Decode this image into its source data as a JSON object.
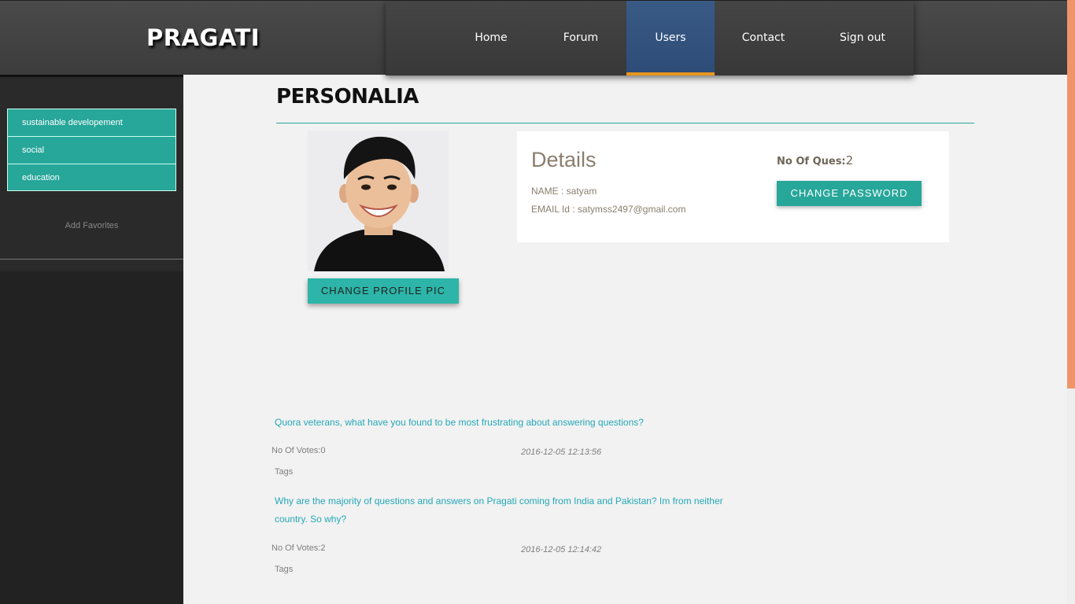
{
  "brand": {
    "logo": "PRAGATI"
  },
  "nav": {
    "items": [
      {
        "label": "Home",
        "active": false
      },
      {
        "label": "Forum",
        "active": false
      },
      {
        "label": "Users",
        "active": true
      },
      {
        "label": "Contact",
        "active": false
      },
      {
        "label": "Sign out",
        "active": false
      }
    ]
  },
  "sidebar": {
    "items": [
      {
        "label": "sustainable developement"
      },
      {
        "label": "social"
      },
      {
        "label": "education"
      }
    ],
    "add_favorites": "Add Favorites"
  },
  "main": {
    "title": "PERSONALIA",
    "change_pic_label": "CHANGE PROFILE PIC",
    "details": {
      "heading": "Details",
      "name": "NAME : satyam",
      "email": "EMAIL Id : satymss2497@gmail.com",
      "ques_label": "No Of Ques:",
      "ques_count": "2",
      "change_password_label": "CHANGE PASSWORD"
    },
    "questions": [
      {
        "title": "Quora veterans, what have you found to be most frustrating about answering questions?",
        "votes": "No Of Votes:0",
        "date": "2016-12-05 12:13:56",
        "tags": "Tags"
      },
      {
        "title": "Why are the majority of questions and answers on Pragati coming from India and Pakistan? Im from neither country. So why?",
        "votes": "No Of Votes:2",
        "date": "2016-12-05 12:14:42",
        "tags": "Tags"
      }
    ]
  },
  "colors": {
    "accent": "#27a69a",
    "nav_active": "#2d4c78",
    "nav_indicator": "#e8961e",
    "link": "#24a8b8",
    "scroll_thumb": "#f0956a"
  }
}
